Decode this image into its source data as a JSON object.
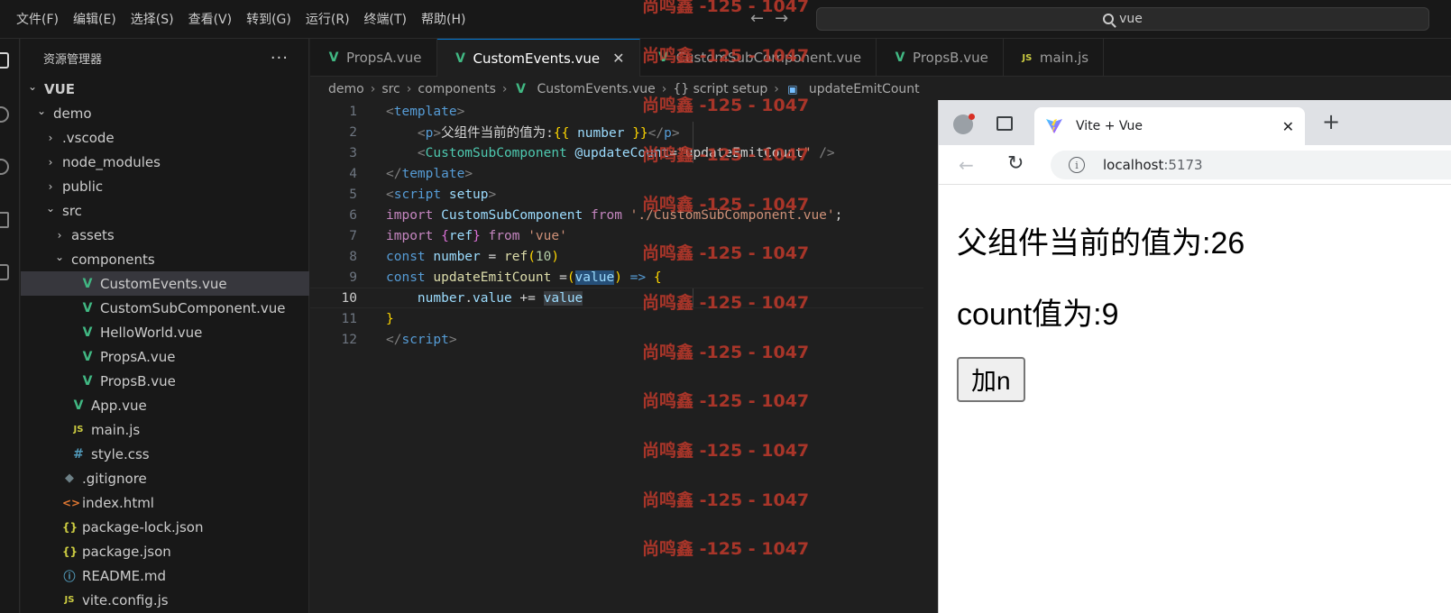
{
  "menu": [
    "文件(F)",
    "编辑(E)",
    "选择(S)",
    "查看(V)",
    "转到(G)",
    "运行(R)",
    "终端(T)",
    "帮助(H)"
  ],
  "search": {
    "text": "vue"
  },
  "sidebar": {
    "title": "资源管理器",
    "more": "···",
    "tree": [
      {
        "label": "VUE",
        "depth": 0,
        "kind": "folder-open",
        "bold": true
      },
      {
        "label": "demo",
        "depth": 1,
        "kind": "folder-open"
      },
      {
        "label": ".vscode",
        "depth": 2,
        "kind": "folder"
      },
      {
        "label": "node_modules",
        "depth": 2,
        "kind": "folder"
      },
      {
        "label": "public",
        "depth": 2,
        "kind": "folder"
      },
      {
        "label": "src",
        "depth": 2,
        "kind": "folder-open"
      },
      {
        "label": "assets",
        "depth": 3,
        "kind": "folder"
      },
      {
        "label": "components",
        "depth": 3,
        "kind": "folder-open"
      },
      {
        "label": "CustomEvents.vue",
        "depth": 4,
        "kind": "vue",
        "selected": true
      },
      {
        "label": "CustomSubComponent.vue",
        "depth": 4,
        "kind": "vue"
      },
      {
        "label": "HelloWorld.vue",
        "depth": 4,
        "kind": "vue"
      },
      {
        "label": "PropsA.vue",
        "depth": 4,
        "kind": "vue"
      },
      {
        "label": "PropsB.vue",
        "depth": 4,
        "kind": "vue"
      },
      {
        "label": "App.vue",
        "depth": 3,
        "kind": "vue"
      },
      {
        "label": "main.js",
        "depth": 3,
        "kind": "js"
      },
      {
        "label": "style.css",
        "depth": 3,
        "kind": "css"
      },
      {
        "label": ".gitignore",
        "depth": 2,
        "kind": "git"
      },
      {
        "label": "index.html",
        "depth": 2,
        "kind": "html"
      },
      {
        "label": "package-lock.json",
        "depth": 2,
        "kind": "json"
      },
      {
        "label": "package.json",
        "depth": 2,
        "kind": "json"
      },
      {
        "label": "README.md",
        "depth": 2,
        "kind": "info"
      },
      {
        "label": "vite.config.js",
        "depth": 2,
        "kind": "js"
      }
    ]
  },
  "icons": {
    "vue": "V",
    "js": "JS",
    "css": "#",
    "git": "◆",
    "html": "<>",
    "json": "{}",
    "info": "ⓘ"
  },
  "tabs": [
    {
      "label": "PropsA.vue",
      "kind": "vue"
    },
    {
      "label": "CustomEvents.vue",
      "kind": "vue",
      "active": true
    },
    {
      "label": "CustomSubComponent.vue",
      "kind": "vue"
    },
    {
      "label": "PropsB.vue",
      "kind": "vue"
    },
    {
      "label": "main.js",
      "kind": "js"
    }
  ],
  "breadcrumb": [
    "demo",
    "src",
    "components",
    "CustomEvents.vue",
    "{} script setup",
    "updateEmitCount"
  ],
  "code": [
    {
      "n": "1",
      "tokens": [
        [
          "t-tag",
          "<"
        ],
        [
          "t-name",
          "template"
        ],
        [
          "t-tag",
          ">"
        ]
      ]
    },
    {
      "n": "2",
      "tokens": [
        [
          "t-plain",
          "    "
        ],
        [
          "t-tag",
          "<"
        ],
        [
          "t-name",
          "p"
        ],
        [
          "t-tag",
          ">"
        ],
        [
          "t-plain",
          "父组件当前的值为:"
        ],
        [
          "t-brace",
          "{{"
        ],
        [
          "t-plain",
          " "
        ],
        [
          "t-var",
          "number"
        ],
        [
          "t-plain",
          " "
        ],
        [
          "t-brace",
          "}}"
        ],
        [
          "t-tag",
          "</"
        ],
        [
          "t-name",
          "p"
        ],
        [
          "t-tag",
          ">"
        ]
      ]
    },
    {
      "n": "3",
      "tokens": [
        [
          "t-plain",
          "    "
        ],
        [
          "t-tag",
          "<"
        ],
        [
          "t-comp",
          "CustomSubComponent"
        ],
        [
          "t-plain",
          " "
        ],
        [
          "t-attr",
          "@updateCount"
        ],
        [
          "t-plain",
          "="
        ],
        [
          "t-str",
          "\""
        ],
        [
          "t-plain",
          "updateEmitCount"
        ],
        [
          "t-str",
          "\""
        ],
        [
          "t-plain",
          " "
        ],
        [
          "t-tag",
          "/>"
        ]
      ]
    },
    {
      "n": "4",
      "tokens": [
        [
          "t-tag",
          "</"
        ],
        [
          "t-name",
          "template"
        ],
        [
          "t-tag",
          ">"
        ]
      ]
    },
    {
      "n": "5",
      "tokens": [
        [
          "t-tag",
          "<"
        ],
        [
          "t-name",
          "script"
        ],
        [
          "t-plain",
          " "
        ],
        [
          "t-attr",
          "setup"
        ],
        [
          "t-tag",
          ">"
        ]
      ]
    },
    {
      "n": "6",
      "tokens": [
        [
          "t-kw",
          "import"
        ],
        [
          "t-plain",
          " "
        ],
        [
          "t-var",
          "CustomSubComponent"
        ],
        [
          "t-plain",
          " "
        ],
        [
          "t-kw",
          "from"
        ],
        [
          "t-plain",
          " "
        ],
        [
          "t-str",
          "'./CustomSubComponent.vue'"
        ],
        [
          "t-plain",
          ";"
        ]
      ]
    },
    {
      "n": "7",
      "tokens": [
        [
          "t-kw",
          "import"
        ],
        [
          "t-plain",
          " "
        ],
        [
          "t-brace2",
          "{"
        ],
        [
          "t-var",
          "ref"
        ],
        [
          "t-brace2",
          "}"
        ],
        [
          "t-plain",
          " "
        ],
        [
          "t-kw",
          "from"
        ],
        [
          "t-plain",
          " "
        ],
        [
          "t-str",
          "'vue'"
        ]
      ]
    },
    {
      "n": "8",
      "tokens": [
        [
          "t-decl",
          "const"
        ],
        [
          "t-plain",
          " "
        ],
        [
          "t-var",
          "number"
        ],
        [
          "t-plain",
          " = "
        ],
        [
          "t-fn",
          "ref"
        ],
        [
          "t-brace",
          "("
        ],
        [
          "t-num",
          "10"
        ],
        [
          "t-brace",
          ")"
        ]
      ]
    },
    {
      "n": "9",
      "tokens": [
        [
          "t-decl",
          "const"
        ],
        [
          "t-plain",
          " "
        ],
        [
          "t-fn",
          "updateEmitCount"
        ],
        [
          "t-plain",
          " ="
        ],
        [
          "t-brace",
          "("
        ],
        [
          "t-var t-sel",
          "value"
        ],
        [
          "t-brace",
          ")"
        ],
        [
          "t-plain",
          " "
        ],
        [
          "t-decl",
          "=>"
        ],
        [
          "t-plain",
          " "
        ],
        [
          "t-brace",
          "{"
        ]
      ]
    },
    {
      "n": "10",
      "current": true,
      "tokens": [
        [
          "t-plain",
          "    "
        ],
        [
          "t-var",
          "number"
        ],
        [
          "t-plain",
          "."
        ],
        [
          "t-var",
          "value"
        ],
        [
          "t-plain",
          " += "
        ],
        [
          "t-var t-hl",
          "value"
        ]
      ]
    },
    {
      "n": "11",
      "tokens": [
        [
          "t-brace",
          "}"
        ]
      ]
    },
    {
      "n": "12",
      "tokens": [
        [
          "t-tag",
          "</"
        ],
        [
          "t-name",
          "script"
        ],
        [
          "t-tag",
          ">"
        ]
      ]
    }
  ],
  "watermark": "尚鸣鑫 -125 - 1047",
  "browser": {
    "tab_title": "Vite + Vue",
    "url_host": "localhost",
    "url_port": ":5173",
    "p1": "父组件当前的值为:26",
    "p2": "count值为:9",
    "button": "加n"
  }
}
